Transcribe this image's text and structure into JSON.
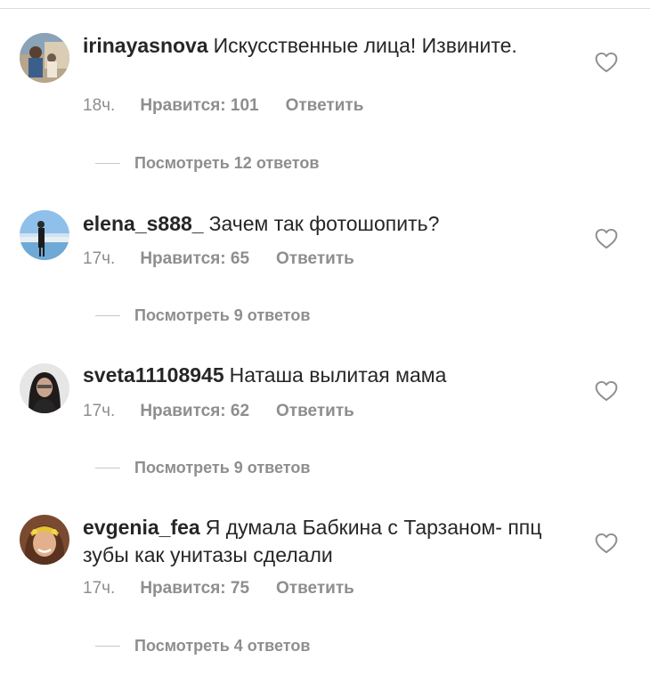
{
  "comments": [
    {
      "username": "irinayasnova",
      "text": "Искусственные лица! Извините.",
      "time": "18ч.",
      "likes": "Нравится: 101",
      "reply": "Ответить",
      "view_replies": "Посмотреть 12 ответов",
      "avatar_colors": [
        "#6d5a4a",
        "#c9b79c",
        "#3b5f8a"
      ]
    },
    {
      "username": "elena_s888_",
      "text": "Зачем так фотошопить?",
      "time": "17ч.",
      "likes": "Нравится: 65",
      "reply": "Ответить",
      "view_replies": "Посмотреть 9 ответов",
      "avatar_colors": [
        "#7fb4e6",
        "#d8e6ef",
        "#2a2a2a"
      ]
    },
    {
      "username": "sveta11108945",
      "text": "Наташа вылитая мама",
      "time": "17ч.",
      "likes": "Нравится: 62",
      "reply": "Ответить",
      "view_replies": "Посмотреть 9 ответов",
      "avatar_colors": [
        "#e4e4e4",
        "#1f1b1b",
        "#c8a48e"
      ]
    },
    {
      "username": "evgenia_fea",
      "text": "Я думала Бабкина с Тарзаном- ппц зубы как унитазы сделали",
      "time": "17ч.",
      "likes": "Нравится: 75",
      "reply": "Ответить",
      "view_replies": "Посмотреть 4 ответов",
      "avatar_colors": [
        "#8b4f2e",
        "#e5c23a",
        "#d8a27e"
      ]
    }
  ],
  "icons": {
    "like": "heart-outline-icon"
  }
}
